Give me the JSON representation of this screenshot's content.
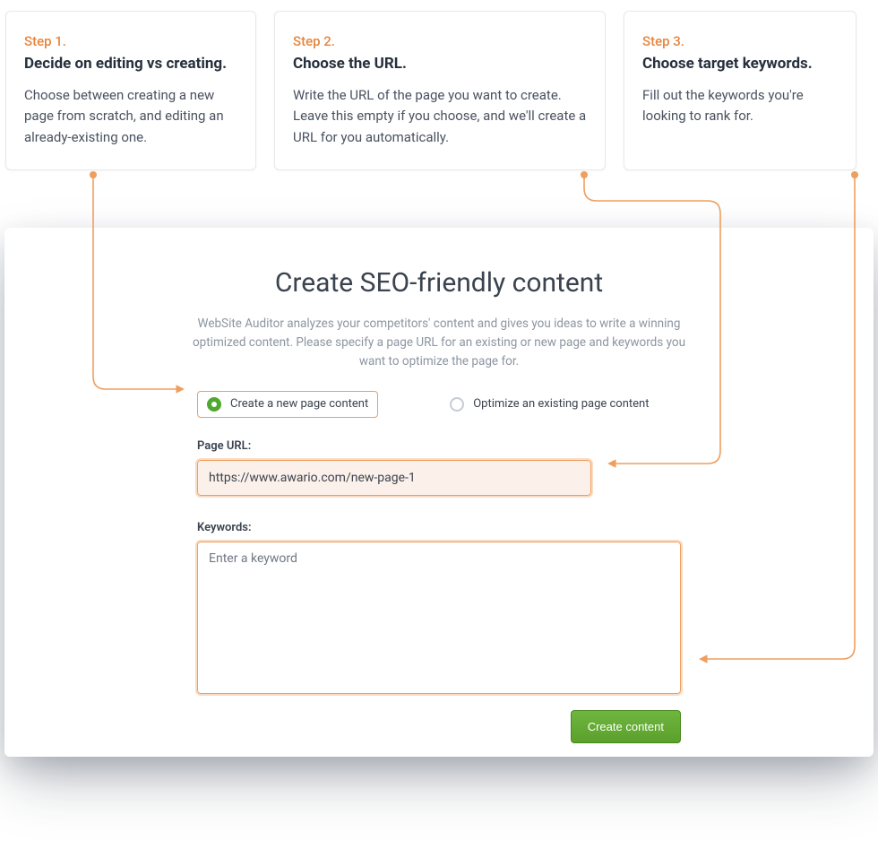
{
  "steps": [
    {
      "num": "Step 1.",
      "title": "Decide on editing vs creating.",
      "desc": "Choose between creating a new page from scratch, and editing an already-existing one."
    },
    {
      "num": "Step 2.",
      "title": "Choose the URL.",
      "desc": "Write the URL of the page you want to create. Leave this empty if you choose, and we'll create a URL for you automatically."
    },
    {
      "num": "Step 3.",
      "title": "Choose target keywords.",
      "desc": "Fill out the keywords you're looking to rank for."
    }
  ],
  "panel": {
    "title": "Create SEO-friendly content",
    "subtitle": "WebSite Auditor analyzes your competitors' content and gives you ideas to write a winning optimized content. Please specify a page URL for an existing or new page and keywords you want to optimize the page for."
  },
  "radios": {
    "create": "Create a new page content",
    "optimize": "Optimize an existing page content"
  },
  "url": {
    "label": "Page URL:",
    "value": "https://www.awario.com/new-page-1"
  },
  "keywords": {
    "label": "Keywords:",
    "placeholder": "Enter a keyword"
  },
  "submit": "Create content"
}
